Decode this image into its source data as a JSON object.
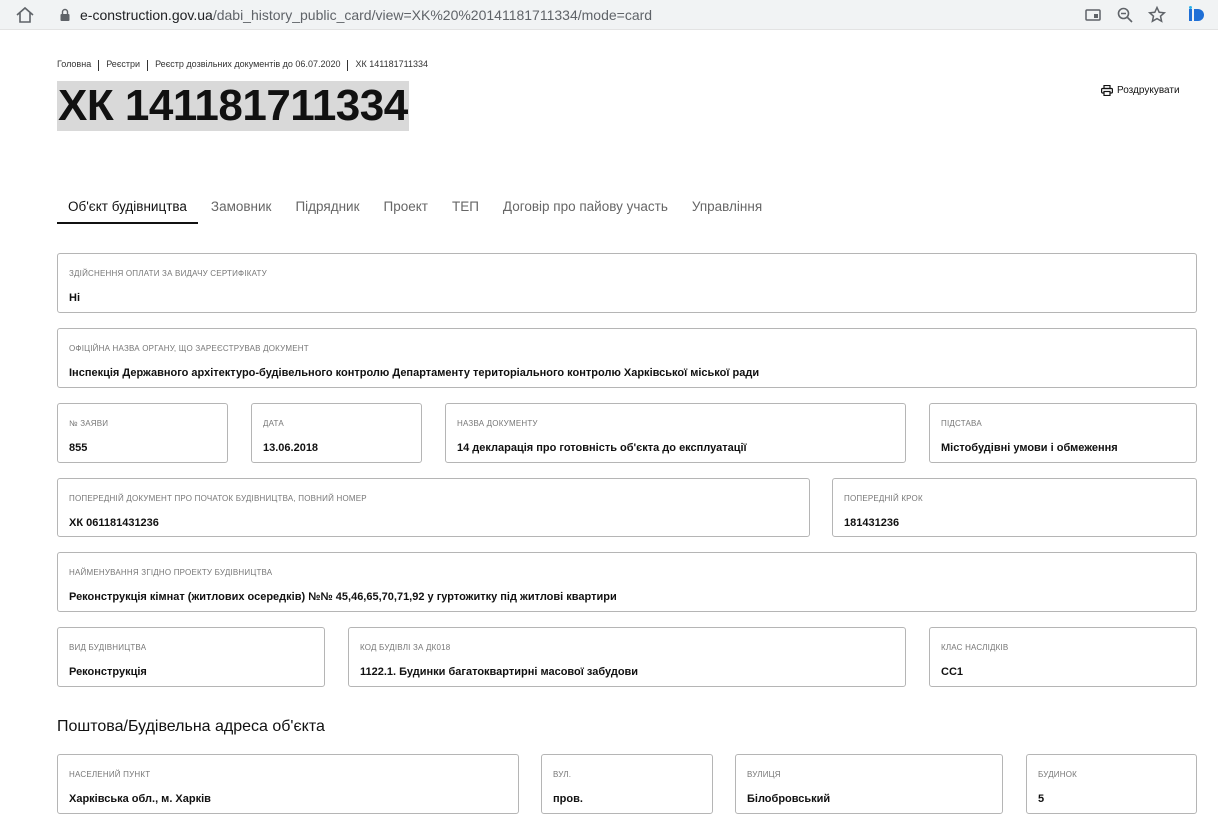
{
  "browser": {
    "url_host": "e-construction.gov.ua",
    "url_path": "/dabi_history_public_card/view=XK%20%20141181711334/mode=card",
    "icons": [
      "home-icon",
      "lock-icon",
      "cast-icon",
      "zoom-icon",
      "star-icon",
      "id-extension-icon"
    ]
  },
  "breadcrumb": {
    "items": [
      "Головна",
      "Реєстри",
      "Реєстр дозвільних документів до 06.07.2020",
      "ХК 141181711334"
    ]
  },
  "page": {
    "title": "ХК 141181711334",
    "print_label": "Роздрукувати"
  },
  "tabs": [
    {
      "label": "Об'єкт будівництва",
      "active": true
    },
    {
      "label": "Замовник"
    },
    {
      "label": "Підрядник"
    },
    {
      "label": "Проект"
    },
    {
      "label": "ТЕП"
    },
    {
      "label": "Договір про пайову участь"
    },
    {
      "label": "Управління"
    }
  ],
  "fields": {
    "payment": {
      "label": "Здійснення оплати за видачу сертифікату",
      "value": "Ні"
    },
    "authority": {
      "label": "Офіційна назва органу, що зареєстрував документ",
      "value": "Інспекція Державного архітектуро-будівельного контролю Департаменту територіального контролю Харківської міської ради"
    },
    "application_no": {
      "label": "№ заяви",
      "value": "855"
    },
    "date": {
      "label": "Дата",
      "value": "13.06.2018"
    },
    "doc_name": {
      "label": "Назва документу",
      "value": "14 декларація про готовність об'єкта до експлуатації"
    },
    "basis": {
      "label": "Підстава",
      "value": "Містобудівні умови і обмеження"
    },
    "prev_doc": {
      "label": "Попередній документ про початок будівництва, повний номер",
      "value": "ХК 061181431236"
    },
    "prev_step": {
      "label": "Попередній крок",
      "value": "181431236"
    },
    "project_name": {
      "label": "Найменування згідно проекту будівництва",
      "value": "Реконструкція кімнат (житлових осередків) №№ 45,46,65,70,71,92 у гуртожитку під житлові квартири"
    },
    "construction_type": {
      "label": "Вид будівництва",
      "value": "Реконструкція"
    },
    "building_code": {
      "label": "Код будівлі за ДК018",
      "value": "1122.1. Будинки багатоквартирні масової забудови"
    },
    "consequence_class": {
      "label": "Клас наслідків",
      "value": "СС1"
    }
  },
  "address": {
    "section_title": "Поштова/Будівельна адреса об'єкта",
    "locality": {
      "label": "Населений пункт",
      "value": "Харківська обл., м. Харків"
    },
    "street_type": {
      "label": "Вул.",
      "value": "пров."
    },
    "street": {
      "label": "Вулиця",
      "value": "Білобровський"
    },
    "house": {
      "label": "Будинок",
      "value": "5"
    }
  }
}
